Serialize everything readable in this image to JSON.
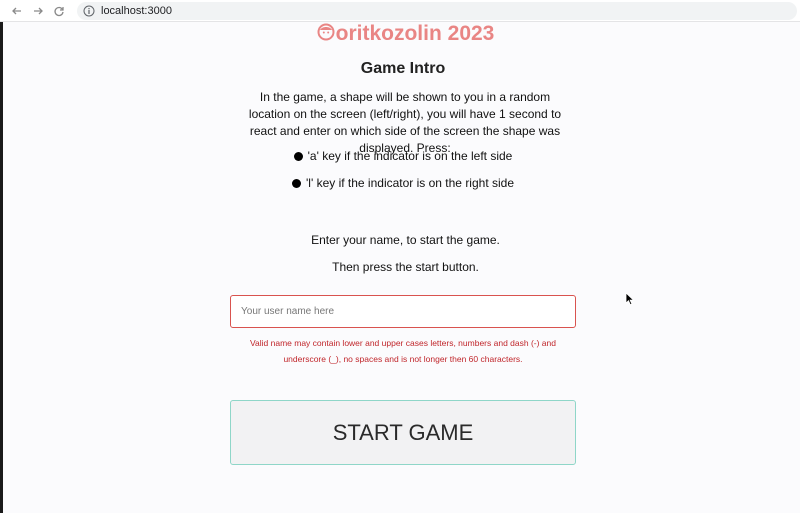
{
  "browser": {
    "url": "localhost:3000"
  },
  "header": {
    "logo_text": "oritkozolin 2023",
    "logo_icon": "face-icon",
    "brand_color": "#e98584"
  },
  "main": {
    "title": "Game Intro",
    "intro": "In the game, a shape will be shown to you in a random location on the screen (left/right), you will have 1 second to react and enter on which side of the screen the shape was displayed. Press:",
    "keys": [
      "'a' key if the indicator is on the left side",
      "'l' key if the indicator is on the right side"
    ],
    "prompt_line1": "Enter your name, to start the game.",
    "prompt_line2": "Then press the start button.",
    "name_input": {
      "placeholder": "Your user name here",
      "value": ""
    },
    "validation_message": "Valid name may contain lower and upper cases letters, numbers and dash (-) and underscore (_), no spaces and is not longer then 60 characters.",
    "error_color": "#c0262b",
    "start_button_label": "START GAME"
  }
}
